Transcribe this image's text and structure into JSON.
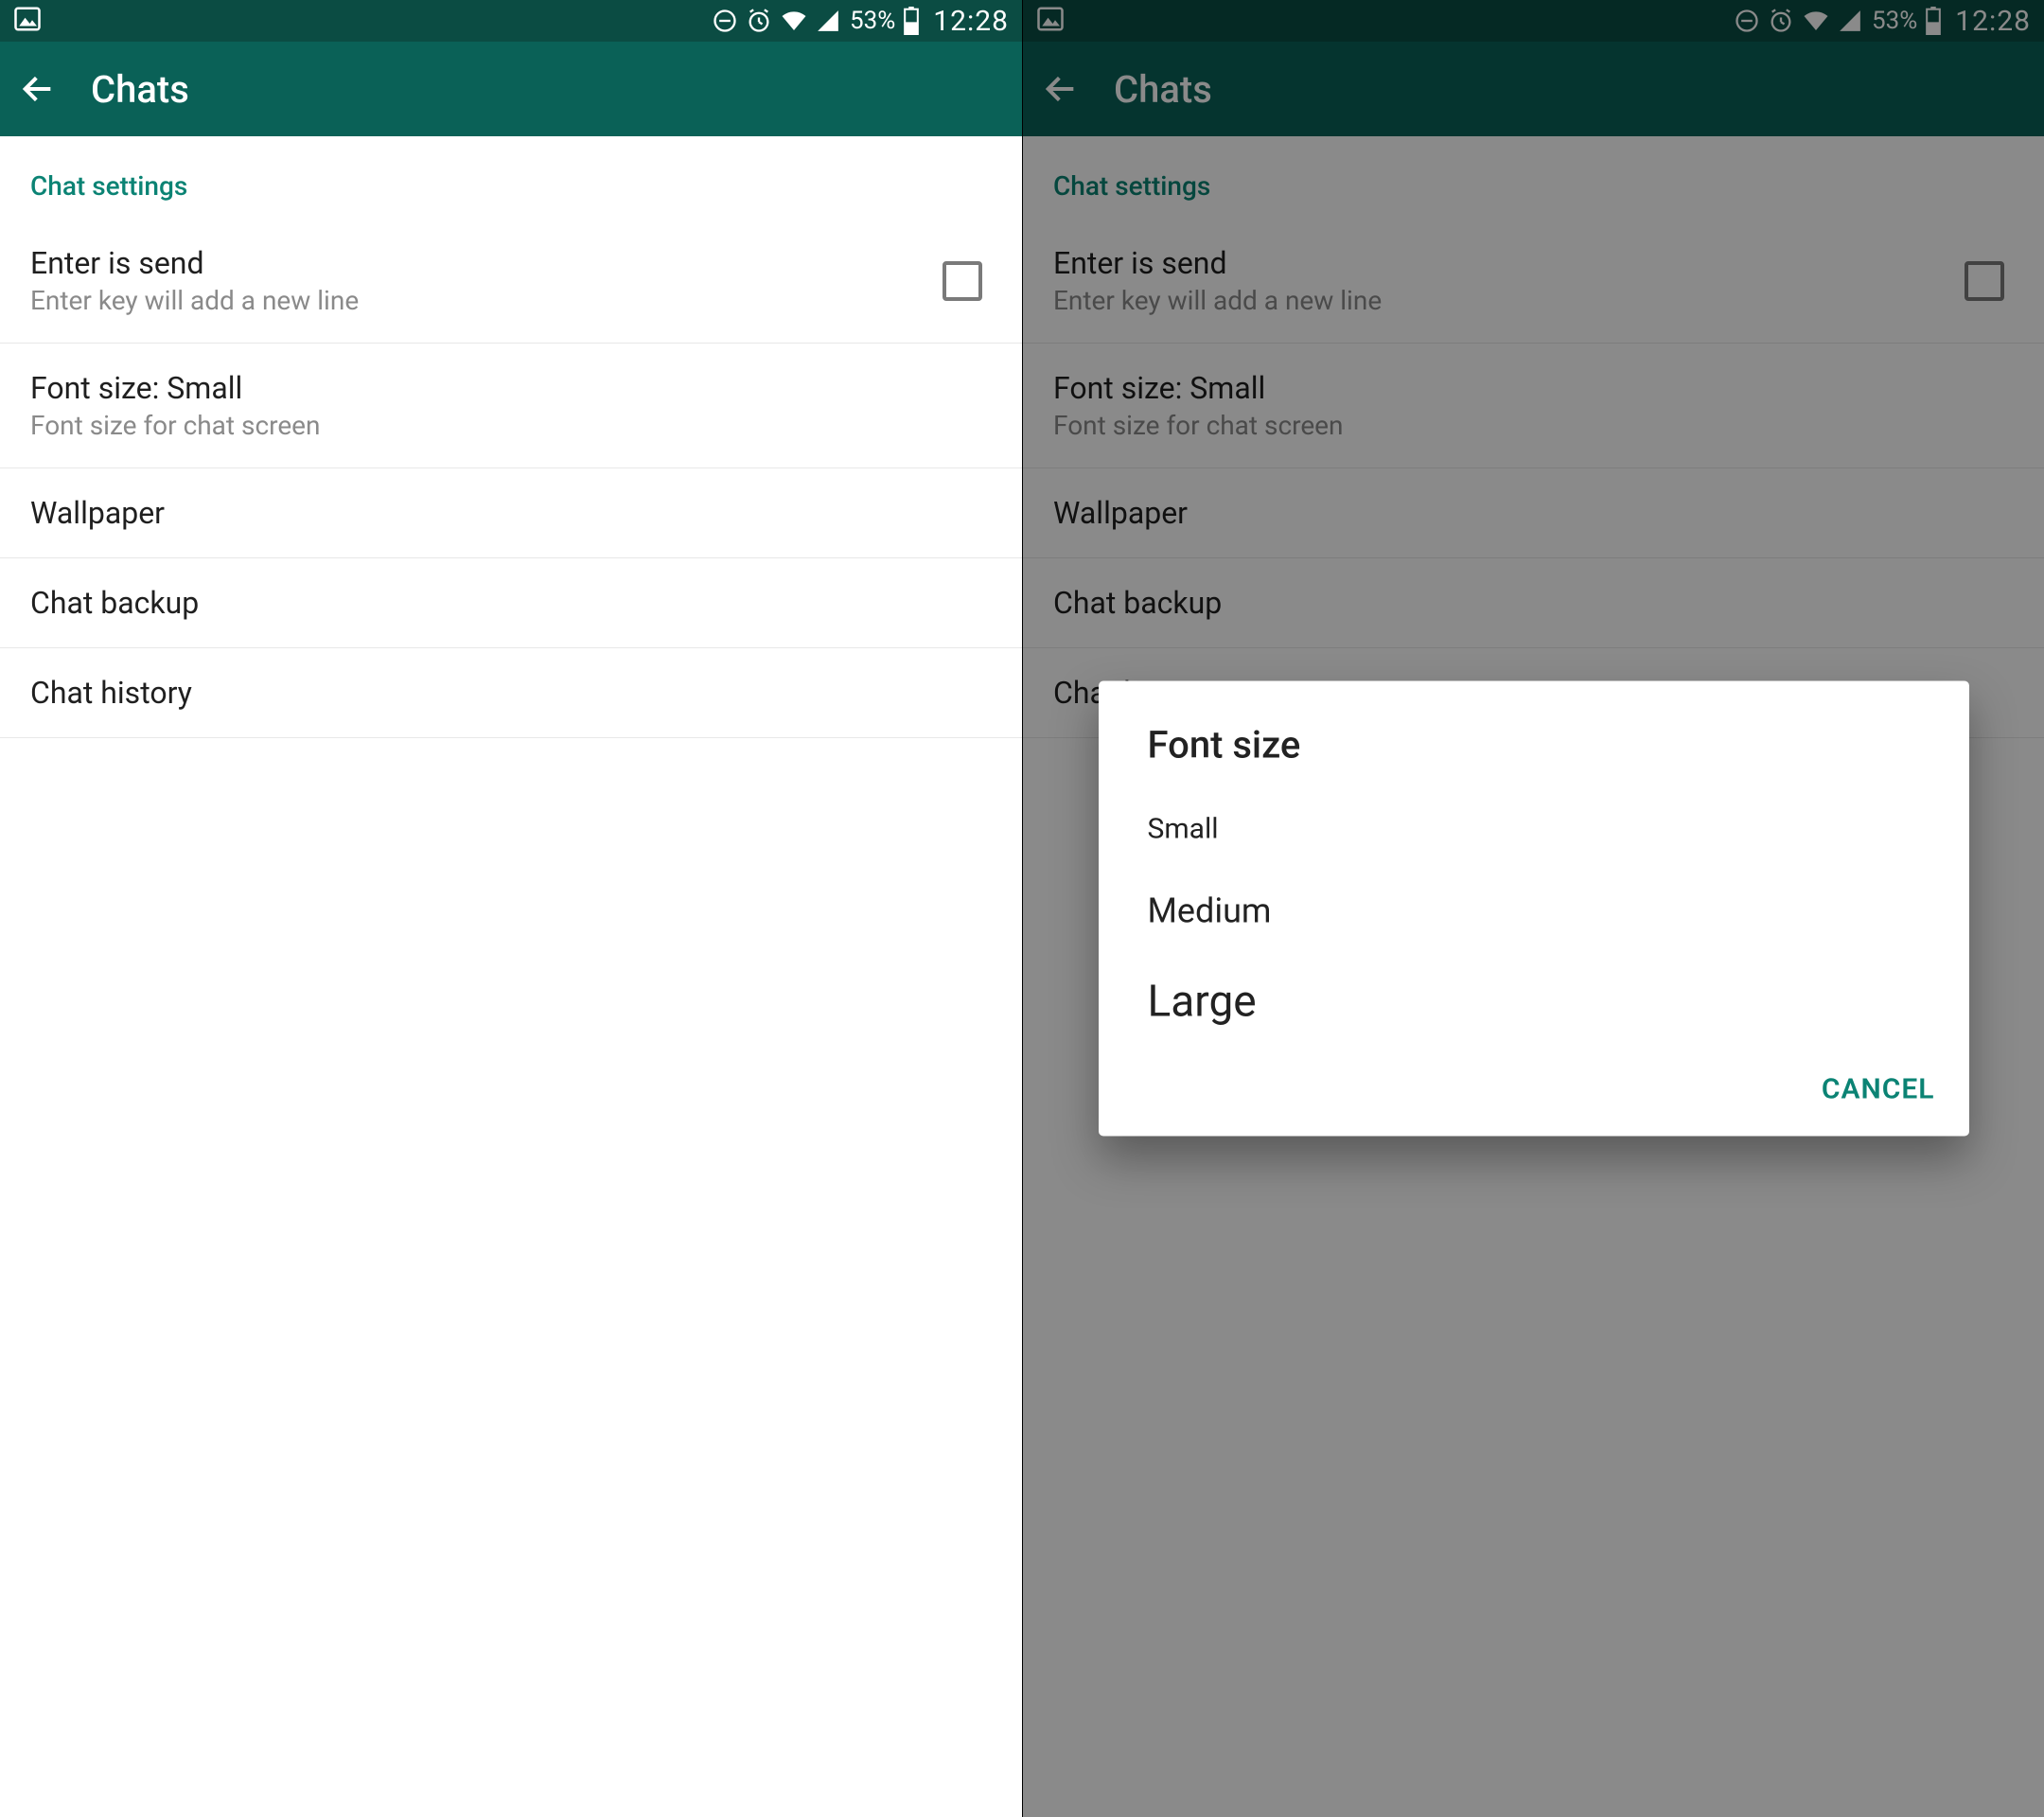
{
  "status": {
    "battery_pct": "53%",
    "time": "12:28"
  },
  "appbar": {
    "title": "Chats"
  },
  "section_label": "Chat settings",
  "items": {
    "enter_send": {
      "title": "Enter is send",
      "subtitle": "Enter key will add a new line"
    },
    "font_size": {
      "title": "Font size: Small",
      "subtitle": "Font size for chat screen"
    },
    "wallpaper": {
      "title": "Wallpaper"
    },
    "chat_backup": {
      "title": "Chat backup"
    },
    "chat_history": {
      "title": "Chat history"
    }
  },
  "dialog": {
    "title": "Font size",
    "options": {
      "small": "Small",
      "medium": "Medium",
      "large": "Large"
    },
    "cancel": "CANCEL"
  }
}
